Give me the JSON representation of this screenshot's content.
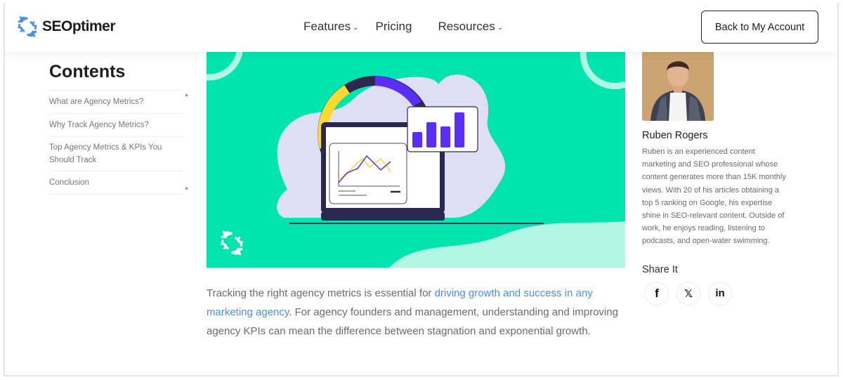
{
  "header": {
    "brand": "SEOptimer",
    "nav": [
      {
        "label": "Features",
        "has_dropdown": true
      },
      {
        "label": "Pricing",
        "has_dropdown": false
      },
      {
        "label": "Resources",
        "has_dropdown": true
      }
    ],
    "back_button": "Back to My Account",
    "chevron_glyph": "⌄"
  },
  "toc": {
    "title": "Contents",
    "items": [
      "What are Agency Metrics?",
      "Why Track Agency Metrics?",
      "Top Agency Metrics & KPIs You Should Track",
      "Conclusion"
    ],
    "scroll_up": "▲",
    "scroll_down": "▼"
  },
  "hero": {
    "description": "Illustration of laptop with line chart, bar chart and donut ring",
    "colors": {
      "background": "#00e5b0",
      "light_accent": "#b2f7e3",
      "blob": "#dedff5",
      "dark": "#2b2850",
      "purple": "#5b2ef5",
      "yellow": "#fbd933"
    }
  },
  "article": {
    "text_before_link": "Tracking the right agency metrics is essential for ",
    "link_text": "driving growth and success in any marketing agency",
    "text_after_link": ". For agency founders and management, understanding and improving agency KPIs can mean the difference between stagnation and exponential growth."
  },
  "author": {
    "name": "Ruben Rogers",
    "bio": "Ruben is an experienced content marketing and SEO professional whose content generates more than 15K monthly views. With 20 of his articles obtaining a top 5 ranking on Google, his expertise shine in SEO-relevant content. Outside of work, he enjoys reading, listening to podcasts, and open-water swimming."
  },
  "share": {
    "title": "Share It",
    "buttons": [
      {
        "network": "facebook",
        "glyph": "f"
      },
      {
        "network": "x",
        "glyph": "𝕏"
      },
      {
        "network": "linkedin",
        "glyph": "in"
      }
    ]
  },
  "colors": {
    "link": "#4a90e2",
    "brand_blue": "#4a8fe7",
    "hero_bg": "#00e5b0"
  }
}
